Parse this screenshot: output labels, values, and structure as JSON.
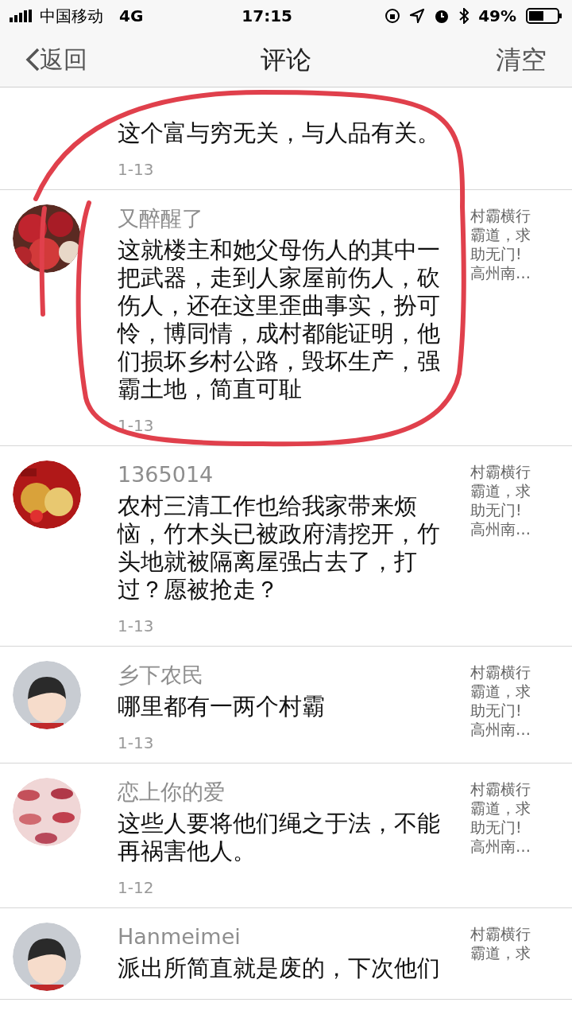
{
  "status_bar": {
    "carrier": "中国移动",
    "network": "4G",
    "time": "17:15",
    "battery": "49%"
  },
  "nav": {
    "back": "返回",
    "title": "评论",
    "action": "清空"
  },
  "comments": [
    {
      "text": "这个富与穷无关，与人品有关。",
      "date": "1-13"
    },
    {
      "name": "又醉醒了",
      "text": "这就楼主和她父母伤人的其中一把武器，走到人家屋前伤人，砍伤人，还在这里歪曲事实，扮可怜，博同情，成村都能证明，他们损坏乡村公路，毁坏生产，强霸土地，简直可耻",
      "date": "1-13",
      "snippet": "村霸横行霸道，求助无门!高州南…"
    },
    {
      "name": "1365014",
      "text": "农村三清工作也给我家带来烦恼，竹木头已被政府清挖开，竹头地就被隔离屋强占去了，打过？愿被抢走？",
      "date": "1-13",
      "snippet": "村霸横行霸道，求助无门!高州南…"
    },
    {
      "name": "乡下农民",
      "text": "哪里都有一两个村霸",
      "date": "1-13",
      "snippet": "村霸横行霸道，求助无门!高州南…"
    },
    {
      "name": "恋上你的爱",
      "text": "这些人要将他们绳之于法，不能再祸害他人。",
      "date": "1-12",
      "snippet": "村霸横行霸道，求助无门!高州南…"
    },
    {
      "name": "Hanmeimei",
      "text": "派出所简直就是废的，下次他们",
      "snippet": "村霸横行霸道，求"
    }
  ]
}
